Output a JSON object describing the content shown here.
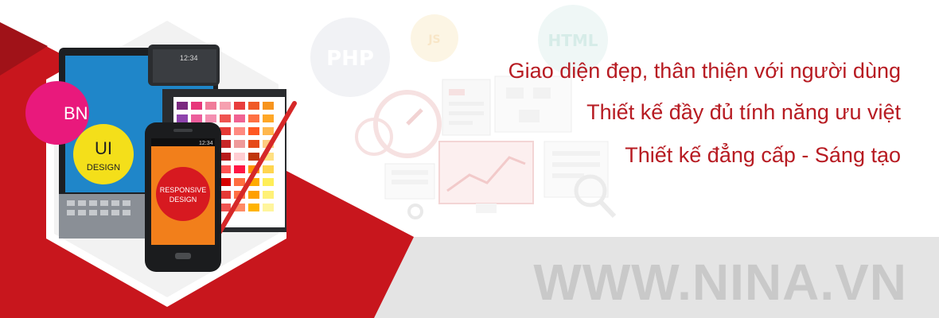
{
  "banner": {
    "taglines": [
      "Giao diện đẹp, thân thiện với người dùng",
      "Thiết kế đầy đủ tính năng ưu việt",
      "Thiết kế đẳng cấp  - Sáng tạo"
    ],
    "website": "WWW.NINA.VN"
  },
  "devices": {
    "ui_badge_line1": "UI",
    "ui_badge_line2": "DESIGN",
    "responsive_line1": "RESPONSIVE",
    "responsive_line2": "DESIGN",
    "laptop_edge_text": "B\nN",
    "status_time_tablet": "12:34",
    "status_time_phone": "12:34"
  },
  "background_icons": [
    "PHP",
    "JS",
    "HTML"
  ],
  "colors": {
    "brand_red": "#b71b22",
    "gray_band": "#e4e4e4",
    "watermark_gray": "#c9c9c9"
  }
}
